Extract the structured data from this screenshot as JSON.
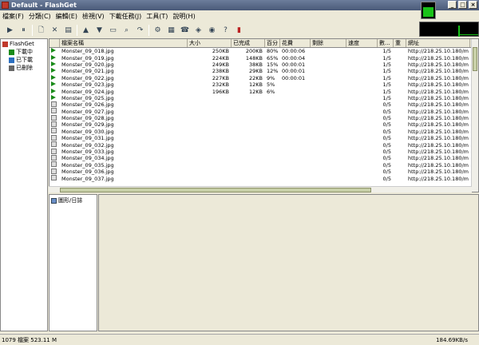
{
  "window": {
    "title": "Default - FlashGet",
    "min": "_",
    "max": "□",
    "close": "×"
  },
  "menu": [
    {
      "label": "檔案(F)"
    },
    {
      "label": "分類(C)"
    },
    {
      "label": "編輯(E)"
    },
    {
      "label": "檢視(V)"
    },
    {
      "label": "下載任務(J)"
    },
    {
      "label": "工具(T)"
    },
    {
      "label": "說明(H)"
    }
  ],
  "toolbar": [
    "start-icon",
    "pause-icon",
    "new-icon",
    "delete-icon",
    "properties-icon",
    "move-up-icon",
    "move-down-icon",
    "open-folder-icon",
    "find-icon",
    "find-next-icon",
    "options-icon",
    "connect-icon",
    "dial-icon",
    "site-explorer-icon",
    "network-icon",
    "help-icon",
    "exit-icon"
  ],
  "tree": [
    {
      "label": "FlashGet",
      "icon": "app-icon"
    },
    {
      "label": "下載中",
      "icon": "downloading-icon"
    },
    {
      "label": "已下載",
      "icon": "downloaded-icon"
    },
    {
      "label": "已刪除",
      "icon": "deleted-icon"
    }
  ],
  "columns": [
    "",
    "檔案名稱",
    "大小",
    "已完成",
    "百分",
    "花費",
    "剩餘",
    "速度",
    "數...",
    "重",
    "網址"
  ],
  "rows": [
    {
      "status": "active",
      "name": "Monster_09_018.jpg",
      "size": "250KB",
      "done": "200KB",
      "pct": "80%",
      "elapsed": "00:00:06",
      "remain": "",
      "speed": "",
      "blocks": "1/5",
      "retry": "",
      "url": "http://218.25.10.180/m"
    },
    {
      "status": "active",
      "name": "Monster_09_019.jpg",
      "size": "224KB",
      "done": "148KB",
      "pct": "65%",
      "elapsed": "00:00:04",
      "remain": "",
      "speed": "",
      "blocks": "1/5",
      "retry": "",
      "url": "http://218.25.10.180/m"
    },
    {
      "status": "active",
      "name": "Monster_09_020.jpg",
      "size": "249KB",
      "done": "38KB",
      "pct": "15%",
      "elapsed": "00:00:01",
      "remain": "",
      "speed": "",
      "blocks": "1/5",
      "retry": "",
      "url": "http://218.25.10.180/m"
    },
    {
      "status": "active",
      "name": "Monster_09_021.jpg",
      "size": "238KB",
      "done": "29KB",
      "pct": "12%",
      "elapsed": "00:00:01",
      "remain": "",
      "speed": "",
      "blocks": "1/5",
      "retry": "",
      "url": "http://218.25.10.180/m"
    },
    {
      "status": "active",
      "name": "Monster_09_022.jpg",
      "size": "227KB",
      "done": "22KB",
      "pct": "9%",
      "elapsed": "00:00:01",
      "remain": "",
      "speed": "",
      "blocks": "1/5",
      "retry": "",
      "url": "http://218.25.10.180/m"
    },
    {
      "status": "active",
      "name": "Monster_09_023.jpg",
      "size": "232KB",
      "done": "12KB",
      "pct": "5%",
      "elapsed": "",
      "remain": "",
      "speed": "",
      "blocks": "1/5",
      "retry": "",
      "url": "http://218.25.10.180/m"
    },
    {
      "status": "active",
      "name": "Monster_09_024.jpg",
      "size": "196KB",
      "done": "12KB",
      "pct": "6%",
      "elapsed": "",
      "remain": "",
      "speed": "",
      "blocks": "1/5",
      "retry": "",
      "url": "http://218.25.10.180/m"
    },
    {
      "status": "active",
      "name": "Monster_09_025.jpg",
      "size": "",
      "done": "",
      "pct": "",
      "elapsed": "",
      "remain": "",
      "speed": "",
      "blocks": "1/5",
      "retry": "",
      "url": "http://218.25.10.180/m"
    },
    {
      "status": "wait",
      "name": "Monster_09_026.jpg",
      "size": "",
      "done": "",
      "pct": "",
      "elapsed": "",
      "remain": "",
      "speed": "",
      "blocks": "0/5",
      "retry": "",
      "url": "http://218.25.10.180/m"
    },
    {
      "status": "wait",
      "name": "Monster_09_027.jpg",
      "size": "",
      "done": "",
      "pct": "",
      "elapsed": "",
      "remain": "",
      "speed": "",
      "blocks": "0/5",
      "retry": "",
      "url": "http://218.25.10.180/m"
    },
    {
      "status": "wait",
      "name": "Monster_09_028.jpg",
      "size": "",
      "done": "",
      "pct": "",
      "elapsed": "",
      "remain": "",
      "speed": "",
      "blocks": "0/5",
      "retry": "",
      "url": "http://218.25.10.180/m"
    },
    {
      "status": "wait",
      "name": "Monster_09_029.jpg",
      "size": "",
      "done": "",
      "pct": "",
      "elapsed": "",
      "remain": "",
      "speed": "",
      "blocks": "0/5",
      "retry": "",
      "url": "http://218.25.10.180/m"
    },
    {
      "status": "wait",
      "name": "Monster_09_030.jpg",
      "size": "",
      "done": "",
      "pct": "",
      "elapsed": "",
      "remain": "",
      "speed": "",
      "blocks": "0/5",
      "retry": "",
      "url": "http://218.25.10.180/m"
    },
    {
      "status": "wait",
      "name": "Monster_09_031.jpg",
      "size": "",
      "done": "",
      "pct": "",
      "elapsed": "",
      "remain": "",
      "speed": "",
      "blocks": "0/5",
      "retry": "",
      "url": "http://218.25.10.180/m"
    },
    {
      "status": "wait",
      "name": "Monster_09_032.jpg",
      "size": "",
      "done": "",
      "pct": "",
      "elapsed": "",
      "remain": "",
      "speed": "",
      "blocks": "0/5",
      "retry": "",
      "url": "http://218.25.10.180/m"
    },
    {
      "status": "wait",
      "name": "Monster_09_033.jpg",
      "size": "",
      "done": "",
      "pct": "",
      "elapsed": "",
      "remain": "",
      "speed": "",
      "blocks": "0/5",
      "retry": "",
      "url": "http://218.25.10.180/m"
    },
    {
      "status": "wait",
      "name": "Monster_09_034.jpg",
      "size": "",
      "done": "",
      "pct": "",
      "elapsed": "",
      "remain": "",
      "speed": "",
      "blocks": "0/5",
      "retry": "",
      "url": "http://218.25.10.180/m"
    },
    {
      "status": "wait",
      "name": "Monster_09_035.jpg",
      "size": "",
      "done": "",
      "pct": "",
      "elapsed": "",
      "remain": "",
      "speed": "",
      "blocks": "0/5",
      "retry": "",
      "url": "http://218.25.10.180/m"
    },
    {
      "status": "wait",
      "name": "Monster_09_036.jpg",
      "size": "",
      "done": "",
      "pct": "",
      "elapsed": "",
      "remain": "",
      "speed": "",
      "blocks": "0/5",
      "retry": "",
      "url": "http://218.25.10.180/m"
    },
    {
      "status": "wait",
      "name": "Monster_09_037.jpg",
      "size": "",
      "done": "",
      "pct": "",
      "elapsed": "",
      "remain": "",
      "speed": "",
      "blocks": "0/5",
      "retry": "",
      "url": "http://218.25.10.180/m"
    }
  ],
  "lower": {
    "tab_label": "圖形/日誌"
  },
  "status": {
    "left": "1079 檔案  523.11 M",
    "right": "184.69KB/s"
  },
  "colors": {
    "accent": "#19c219",
    "titlebar": "#4a5a78",
    "face": "#ece9d8"
  }
}
